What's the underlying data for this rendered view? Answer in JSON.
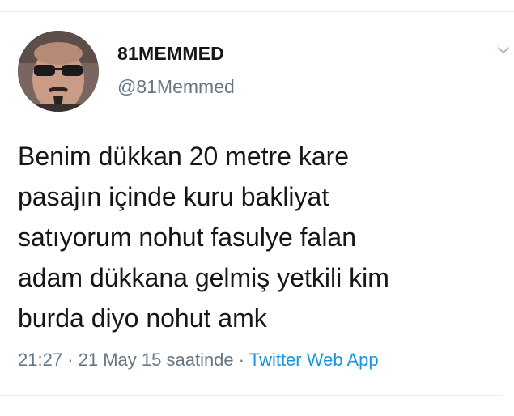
{
  "tweet": {
    "display_name": "81MEMMED",
    "handle": "@81Memmed",
    "text_lines": [
      "Benim dükkan 20 metre kare",
      "pasajın içinde kuru bakliyat",
      "satıyorum nohut fasulye falan",
      "adam dükkana gelmiş yetkili kim",
      "burda diyo nohut amk"
    ],
    "time": "21:27",
    "separator": "·",
    "date": "21 May 15 saatinde",
    "source": "Twitter Web App"
  },
  "icons": {
    "avatar": "user-avatar-photo",
    "menu": "chevron-down-icon"
  },
  "colors": {
    "text": "#14171a",
    "secondary": "#657786",
    "link": "#1b95e0",
    "divider": "#e6ecf0"
  }
}
